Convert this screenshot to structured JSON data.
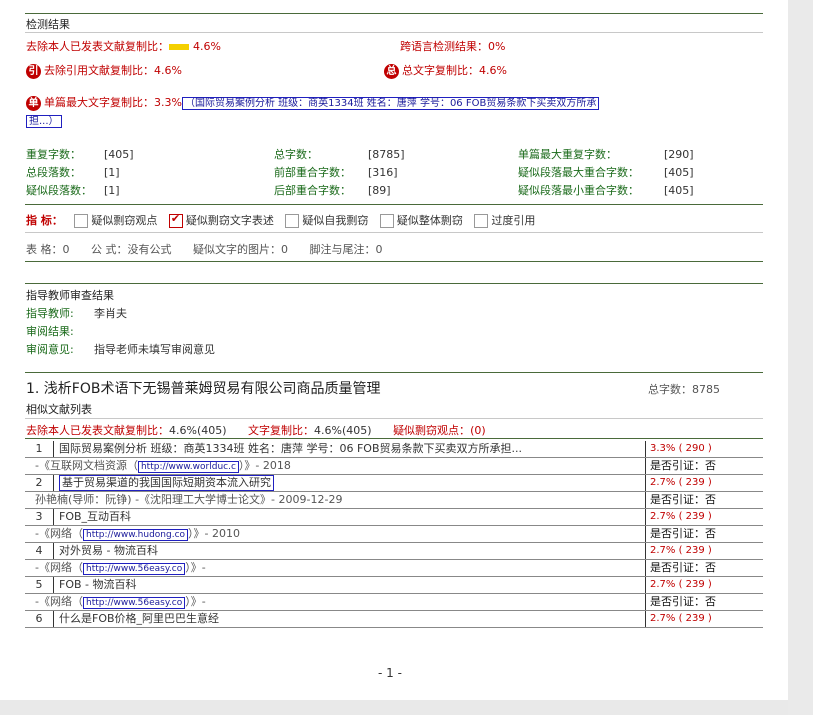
{
  "header": {
    "title": "检测结果"
  },
  "summary": {
    "exclude_self_label": "去除本人已发表文献复制比：",
    "exclude_self_value": "4.6%",
    "cross_lang_label": "跨语言检测结果：",
    "cross_lang_value": "0%",
    "exclude_ref_icon": "引",
    "exclude_ref_label": "去除引用文献复制比：",
    "exclude_ref_value": "4.6%",
    "total_icon": "总",
    "total_label": "总文字复制比：",
    "total_value": "4.6%",
    "single_icon": "单",
    "single_label": "单篇最大文字复制比：",
    "single_value": "3.3%",
    "single_doc_line1": "（国际贸易案例分析 班级：商英1334班 姓名：唐萍 学号：06 FOB贸易条款下买卖双方所承",
    "single_doc_line2": "担...）"
  },
  "stats": [
    {
      "label": "重复字数：",
      "value": "[405]"
    },
    {
      "label": "总字数：",
      "value": "[8785]"
    },
    {
      "label": "单篇最大重复字数：",
      "value": "[290]"
    },
    {
      "label": "总段落数：",
      "value": "[1]"
    },
    {
      "label": "前部重合字数：",
      "value": "[316]"
    },
    {
      "label": "疑似段落最大重合字数：",
      "value": "[405]"
    },
    {
      "label": "疑似段落数：",
      "value": "[1]"
    },
    {
      "label": "后部重合字数：",
      "value": "[89]"
    },
    {
      "label": "疑似段落最小重合字数：",
      "value": "[405]"
    }
  ],
  "indicators": {
    "label": "指 标：",
    "items": [
      {
        "text": "疑似剽窃观点",
        "checked": false
      },
      {
        "text": "疑似剽窃文字表述",
        "checked": true
      },
      {
        "text": "疑似自我剽窃",
        "checked": false
      },
      {
        "text": "疑似整体剽窃",
        "checked": false
      },
      {
        "text": "过度引用",
        "checked": false
      }
    ]
  },
  "misc": {
    "tables_label": "表 格：",
    "tables_value": "0",
    "formula_label": "公 式：",
    "formula_value": "没有公式",
    "images_label": "疑似文字的图片：",
    "images_value": "0",
    "footnote_label": "脚注与尾注：",
    "footnote_value": "0"
  },
  "review": {
    "title": "指导教师审查结果",
    "teacher_label": "指导教师:",
    "teacher_name": "李肖夫",
    "result_label": "审阅结果:",
    "opinion_label": "审阅意见:",
    "opinion_value": "指导老师未填写审阅意见"
  },
  "section": {
    "title": "1. 浅析FOB术语下无锡普莱姆贸易有限公司商品质量管理",
    "word_count": "总字数：8785",
    "list_title": "相似文献列表",
    "ratio1_label": "去除本人已发表文献复制比：",
    "ratio1_value": "4.6%(405)",
    "ratio2_label": "文字复制比：",
    "ratio2_value": "4.6%(405)",
    "plag_label": "疑似剽窃观点：",
    "plag_value": "(0)"
  },
  "docs": [
    {
      "num": "1",
      "title": "国际贸易案例分析 班级：商英1334班 姓名：唐萍 学号：06 FOB贸易条款下买卖双方所承担...",
      "pct": "3.3% ( 290 )",
      "src_pre": "-《互联网文档资源（",
      "src_link": "http://www.worlduc.c",
      "src_post": "）》- 2018",
      "cite": "是否引证：否",
      "boxed": false
    },
    {
      "num": "2",
      "title": "基于贸易渠道的我国国际短期资本流入研究",
      "pct": "2.7% ( 239 )",
      "src_pre": "孙艳楠(导师：阮铮) -《沈阳理工大学博士论文》- 2009-12-29",
      "src_link": "",
      "src_post": "",
      "cite": "是否引证：否",
      "boxed": true
    },
    {
      "num": "3",
      "title": "FOB_互动百科",
      "pct": "2.7% ( 239 )",
      "src_pre": "-《网络（",
      "src_link": "http://www.hudong.co",
      "src_post": "）》- 2010",
      "cite": "是否引证：否",
      "boxed": false
    },
    {
      "num": "4",
      "title": "对外贸易 - 物流百科",
      "pct": "2.7% ( 239 )",
      "src_pre": "-《网络（",
      "src_link": "http://www.56easy.co",
      "src_post": "）》-",
      "cite": "是否引证：否",
      "boxed": false
    },
    {
      "num": "5",
      "title": "FOB - 物流百科",
      "pct": "2.7% ( 239 )",
      "src_pre": "-《网络（",
      "src_link": "http://www.56easy.co",
      "src_post": "）》-",
      "cite": "是否引证：否",
      "boxed": false
    },
    {
      "num": "6",
      "title": "什么是FOB价格_阿里巴巴生意经",
      "pct": "2.7% ( 239 )",
      "src_pre": "",
      "src_link": "",
      "src_post": "",
      "cite": "",
      "boxed": false
    }
  ],
  "footer": {
    "page": "- 1 -"
  }
}
